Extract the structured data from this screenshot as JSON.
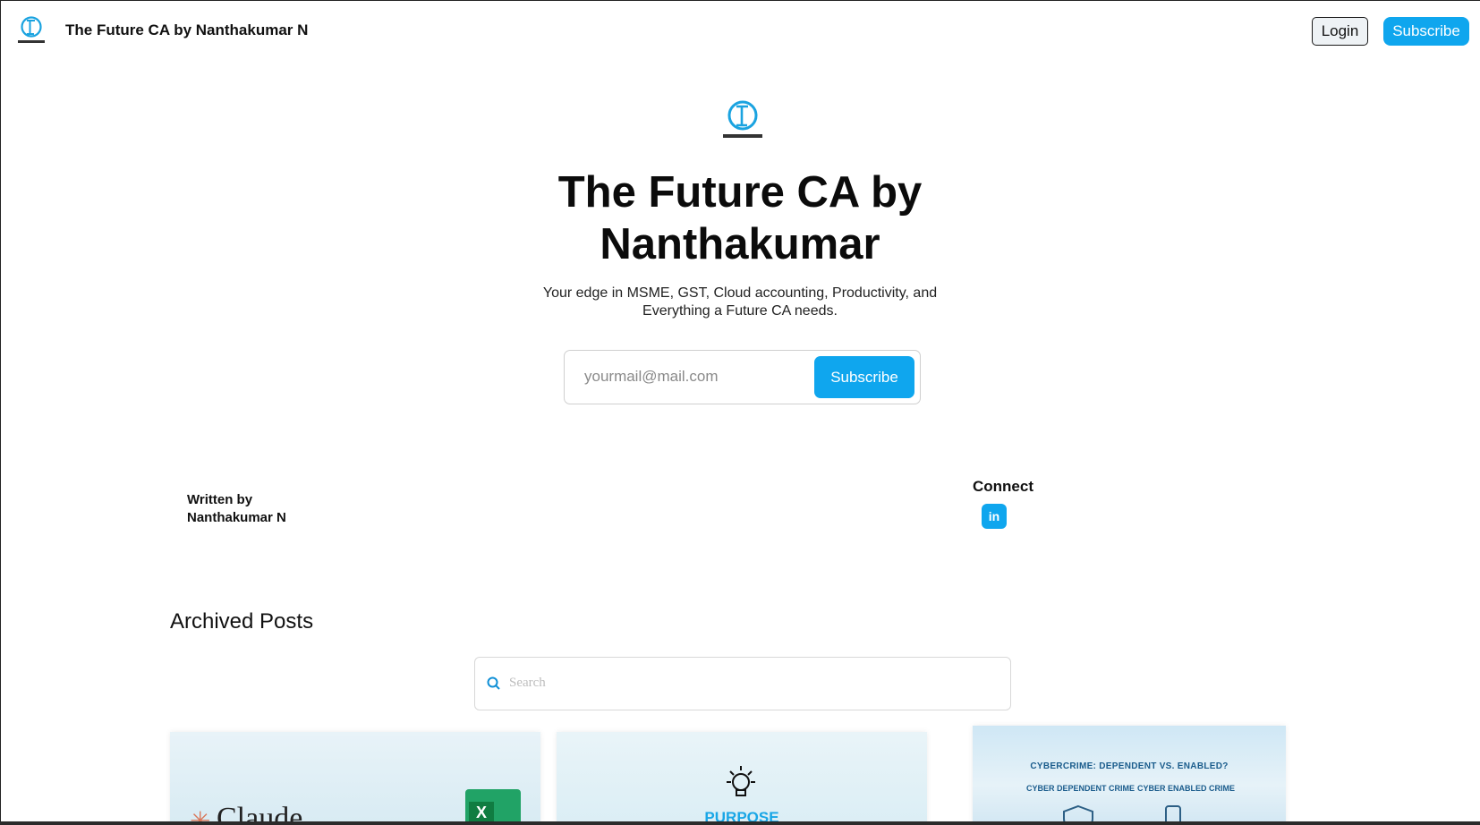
{
  "header": {
    "site_name": "The Future CA by Nanthakumar N",
    "login_label": "Login",
    "subscribe_label": "Subscribe",
    "logo_icon": "future-ca-logo-icon"
  },
  "hero": {
    "title": "The Future CA by Nanthakumar",
    "description": "Your edge in MSME, GST, Cloud accounting, Productivity, and Everything a Future CA needs.",
    "email_placeholder": "yourmail@mail.com",
    "subscribe_label": "Subscribe"
  },
  "author": {
    "written_by_label": "Written by",
    "name": "Nanthakumar N"
  },
  "connect": {
    "title": "Connect",
    "linkedin_label": "in"
  },
  "archive": {
    "title": "Archived Posts",
    "search_placeholder": "Search"
  },
  "cards": [
    {
      "brand_text": "Claude",
      "icon": "excel-icon",
      "excel_letter": "X"
    },
    {
      "text": "PURPOSE",
      "icon": "lightbulb-icon"
    },
    {
      "title": "CYBERCRIME: DEPENDENT VS. ENABLED?",
      "left_label": "CYBER DEPENDENT CRIME",
      "right_label": "CYBER ENABLED CRIME"
    }
  ],
  "colors": {
    "accent": "#0fa6ee",
    "text": "#111111"
  }
}
